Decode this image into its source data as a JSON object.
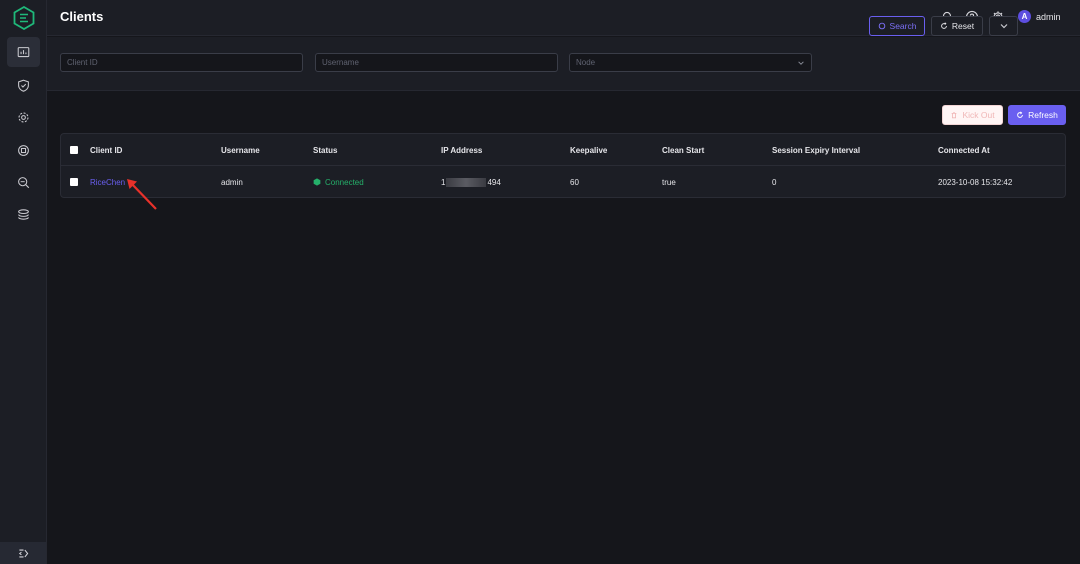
{
  "header": {
    "title": "Clients",
    "user": {
      "avatar_letter": "A",
      "name": "admin"
    }
  },
  "sidebar": {
    "items": [
      {
        "name": "dashboard-icon",
        "active": true
      },
      {
        "name": "shield-icon",
        "active": false
      },
      {
        "name": "gear-cog-icon",
        "active": false
      },
      {
        "name": "integration-icon",
        "active": false
      },
      {
        "name": "diagnose-icon",
        "active": false
      },
      {
        "name": "layers-icon",
        "active": false
      }
    ],
    "collapse_icon": "collapse-icon"
  },
  "filters": {
    "client_id_placeholder": "Client ID",
    "username_placeholder": "Username",
    "node_placeholder": "Node",
    "search_label": "Search",
    "reset_label": "Reset"
  },
  "actions": {
    "kick_out_label": "Kick Out",
    "refresh_label": "Refresh"
  },
  "table": {
    "columns": [
      "Client ID",
      "Username",
      "Status",
      "IP Address",
      "Keepalive",
      "Clean Start",
      "Session Expiry Interval",
      "Connected At"
    ],
    "rows": [
      {
        "client_id": "RiceChen",
        "username": "admin",
        "status": "Connected",
        "ip_prefix": "1",
        "ip_suffix": "494",
        "keepalive": "60",
        "clean_start": "true",
        "session_expiry_interval": "0",
        "connected_at": "2023-10-08 15:32:42"
      }
    ]
  },
  "colors": {
    "accent": "#6a5ff0",
    "connected": "#25b06a",
    "background": "#15161b",
    "panel": "#1c1e25"
  }
}
